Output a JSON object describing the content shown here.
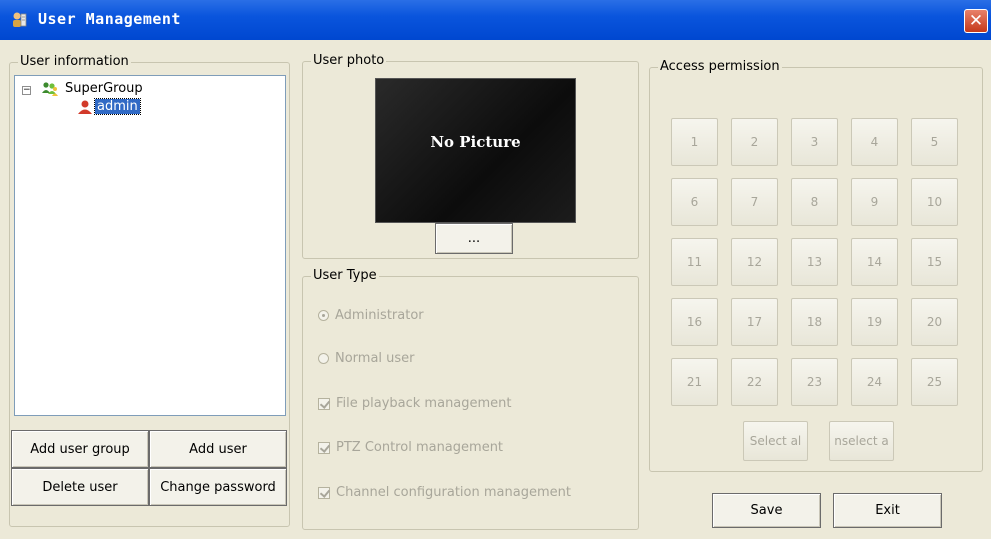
{
  "window": {
    "title": "User Management",
    "close_symbol": "✕"
  },
  "user_info": {
    "label": "User information",
    "tree": {
      "expander": "−",
      "group_name": "SuperGroup",
      "user_name": "admin"
    },
    "buttons": {
      "add_user_group": "Add user group",
      "add_user": "Add user",
      "delete_user": "Delete user",
      "change_password": "Change password"
    }
  },
  "user_photo": {
    "label": "User photo",
    "placeholder_text": "No Picture",
    "browse_label": "..."
  },
  "user_type": {
    "label": "User Type",
    "administrator": "Administrator",
    "normal_user": "Normal user",
    "file_playback": "File playback management",
    "ptz_control": "PTZ Control management",
    "channel_config": "Channel configuration management"
  },
  "access_permission": {
    "label": "Access permission",
    "channels": [
      "1",
      "2",
      "3",
      "4",
      "5",
      "6",
      "7",
      "8",
      "9",
      "10",
      "11",
      "12",
      "13",
      "14",
      "15",
      "16",
      "17",
      "18",
      "19",
      "20",
      "21",
      "22",
      "23",
      "24",
      "25"
    ],
    "select_all": "Select al",
    "unselect_all": "nselect a"
  },
  "actions": {
    "save": "Save",
    "exit": "Exit"
  },
  "colors": {
    "titlebar": "#0a55dd",
    "selection": "#316ac5",
    "disabled_text": "#a8a69a"
  }
}
